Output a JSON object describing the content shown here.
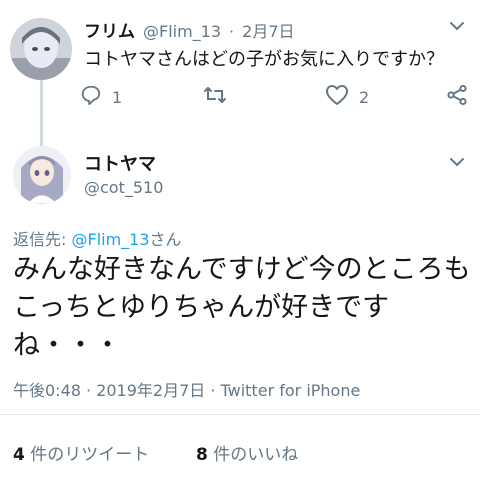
{
  "parent_tweet": {
    "display_name": "フリム",
    "handle": "@Flim_13",
    "separator": "·",
    "date": "2月7日",
    "text": "コトヤマさんはどの子がお気に入りですか？",
    "reply_count": "1",
    "retweet_count": "",
    "like_count": "2"
  },
  "main_tweet": {
    "display_name": "コトヤマ",
    "handle": "@cot_510",
    "reply_prefix": "返信先: ",
    "reply_target": "@Flim_13",
    "reply_suffix": "さん",
    "text": "みんな好きなんですけど今のところもこっちとゆりちゃんが好きですね・・・",
    "timestamp": "午後0:48 · 2019年2月7日 · Twitter for iPhone",
    "retweets_count": "4",
    "retweets_label": "件のリツイート",
    "likes_count": "8",
    "likes_label": "件のいいね"
  },
  "icons": {
    "reply": "reply-icon",
    "retweet": "retweet-icon",
    "like": "heart-icon",
    "share": "share-icon",
    "more": "chevron-down-icon"
  },
  "colors": {
    "text_primary": "#14171a",
    "text_secondary": "#657786",
    "link": "#1da1f2",
    "divider": "#e1e8ed"
  }
}
